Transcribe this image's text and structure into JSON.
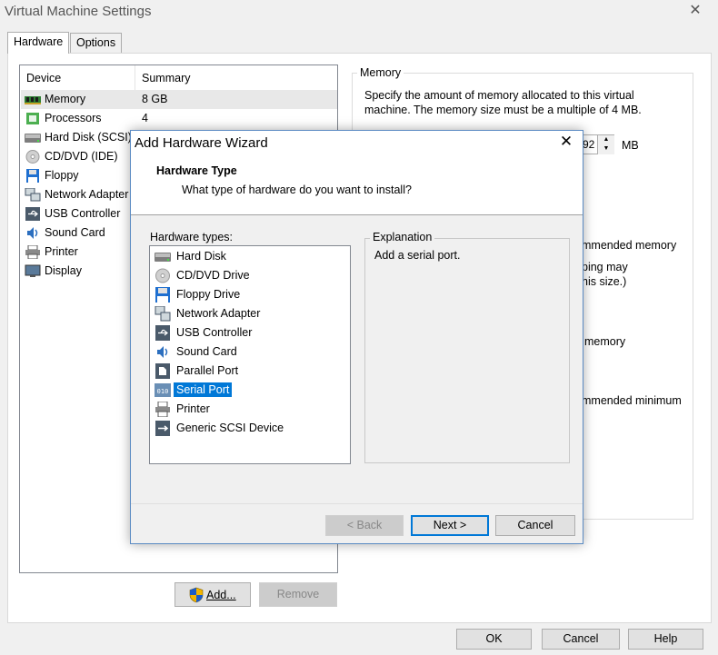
{
  "window": {
    "title": "Virtual Machine Settings",
    "close": "✕"
  },
  "tabs": [
    {
      "label": "Hardware"
    },
    {
      "label": "Options"
    }
  ],
  "device_list": {
    "headers": {
      "device": "Device",
      "summary": "Summary"
    },
    "rows": [
      {
        "name": "Memory",
        "summary": "8 GB",
        "icon": "memory-icon"
      },
      {
        "name": "Processors",
        "summary": "4",
        "icon": "processor-icon"
      },
      {
        "name": "Hard Disk (SCSI)",
        "summary": "",
        "icon": "hard-disk-icon"
      },
      {
        "name": "CD/DVD (IDE)",
        "summary": "",
        "icon": "cd-dvd-icon"
      },
      {
        "name": "Floppy",
        "summary": "",
        "icon": "floppy-icon"
      },
      {
        "name": "Network Adapter",
        "summary": "",
        "icon": "network-adapter-icon"
      },
      {
        "name": "USB Controller",
        "summary": "",
        "icon": "usb-controller-icon"
      },
      {
        "name": "Sound Card",
        "summary": "",
        "icon": "sound-card-icon"
      },
      {
        "name": "Printer",
        "summary": "",
        "icon": "printer-icon"
      },
      {
        "name": "Display",
        "summary": "",
        "icon": "display-icon"
      }
    ]
  },
  "memory_panel": {
    "legend": "Memory",
    "description": "Specify the amount of memory allocated to this virtual machine. The memory size must be a multiple of 4 MB.",
    "value_fragment": "92",
    "unit": "MB",
    "partial_texts": [
      "mmended memory",
      "ping may",
      "his size.)",
      "memory",
      "mmended minimum"
    ]
  },
  "buttons": {
    "add": "Add...",
    "remove": "Remove",
    "ok": "OK",
    "cancel": "Cancel",
    "help": "Help"
  },
  "wizard": {
    "title": "Add Hardware Wizard",
    "close": "✕",
    "heading": "Hardware Type",
    "subheading": "What type of hardware do you want to install?",
    "types_label": "Hardware types:",
    "items": [
      {
        "label": "Hard Disk",
        "icon": "hard-disk-icon"
      },
      {
        "label": "CD/DVD Drive",
        "icon": "cd-dvd-icon"
      },
      {
        "label": "Floppy Drive",
        "icon": "floppy-icon"
      },
      {
        "label": "Network Adapter",
        "icon": "network-adapter-icon"
      },
      {
        "label": "USB Controller",
        "icon": "usb-controller-icon"
      },
      {
        "label": "Sound Card",
        "icon": "sound-card-icon"
      },
      {
        "label": "Parallel Port",
        "icon": "parallel-port-icon"
      },
      {
        "label": "Serial Port",
        "icon": "serial-port-icon"
      },
      {
        "label": "Printer",
        "icon": "printer-icon"
      },
      {
        "label": "Generic SCSI Device",
        "icon": "scsi-device-icon"
      }
    ],
    "selected": "Serial Port",
    "explanation_legend": "Explanation",
    "explanation_text": "Add a serial port.",
    "back": "< Back",
    "next": "Next >",
    "cancel": "Cancel"
  },
  "colors": {
    "selection": "#0078d7",
    "focus_border": "#0078d7",
    "dialog_bg": "#f0f0f0"
  }
}
